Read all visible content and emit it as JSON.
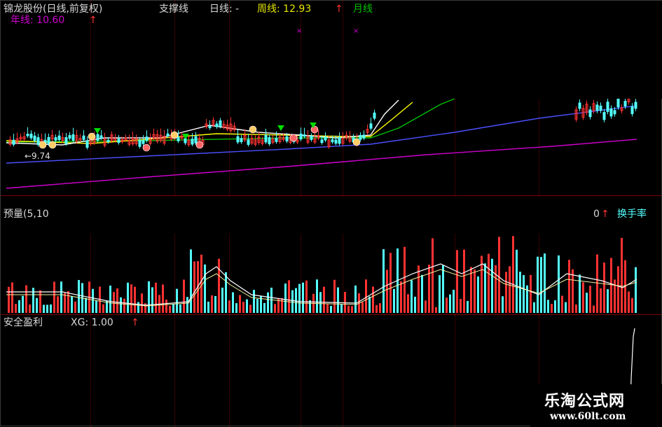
{
  "price_panel": {
    "title": "锦龙股份(日线,前复权)",
    "support_label": "支撑线",
    "daily_label": "日线: -",
    "weekly_label": "周线: 12.93",
    "weekly_arrow": "↑",
    "monthly_label": "月线",
    "yearly_label": "年线: 10.60",
    "yearly_arrow": "↑",
    "low_marker": "←9.74"
  },
  "volume_panel": {
    "title": "预量(5,10",
    "value_tail": "0",
    "arrow": "↑",
    "turnover_label": "换手率"
  },
  "indicator_panel": {
    "title": "安全盈利",
    "value_label": "XG: 1.00",
    "arrow": "↑"
  },
  "watermark": {
    "name": "乐淘公式网",
    "url": "www.60lt.com"
  },
  "colors": {
    "background": "#000000",
    "up": "#ff3232",
    "down": "#54ffff",
    "ma_white": "#ffffff",
    "ma_yellow": "#ffff00",
    "ma_green": "#00c000",
    "ma_blue": "#4b50ff",
    "ma_magenta": "#d000d0",
    "grid": "#7a0000"
  }
}
